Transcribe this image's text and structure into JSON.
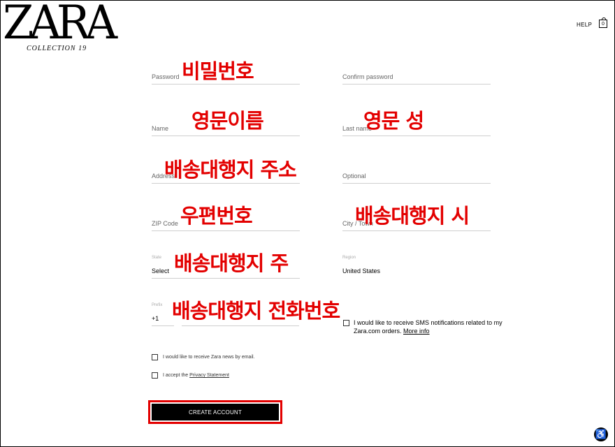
{
  "brand": {
    "logo_text": "ZARA",
    "tagline": "COLLECTION 19"
  },
  "header": {
    "help_label": "HELP",
    "bag_count": "0"
  },
  "form": {
    "password_ph": "Password",
    "confirm_password_ph": "Confirm password",
    "name_ph": "Name",
    "last_name_ph": "Last name",
    "address_ph": "Address",
    "optional_ph": "Optional",
    "zip_ph": "ZIP Code",
    "city_ph": "City / Town",
    "state_label": "State",
    "state_value": "Select",
    "region_label": "Region",
    "region_value": "United States",
    "prefix_label": "Prefix",
    "prefix_value": "+1"
  },
  "annotations": {
    "password": "비밀번호",
    "first_name": "영문이름",
    "last_name": "영문 성",
    "address": "배송대행지 주소",
    "zip": "우편번호",
    "city": "배송대행지 시",
    "state": "배송대행지 주",
    "phone": "배송대행지 전화번호"
  },
  "checkboxes": {
    "sms_text": "I would like to receive SMS notifications related to my Zara.com orders.",
    "sms_link": "More info",
    "news_text": "I would like to receive Zara news by email.",
    "privacy_prefix": "I accept the",
    "privacy_link": "Privacy Statement"
  },
  "actions": {
    "create_account": "CREATE ACCOUNT"
  },
  "colors": {
    "annotation": "#e30000",
    "button_bg": "#000000",
    "field_line": "#cfcfcf"
  },
  "icons": {
    "bag": "shopping-bag-icon",
    "accessibility": "accessibility-icon"
  }
}
